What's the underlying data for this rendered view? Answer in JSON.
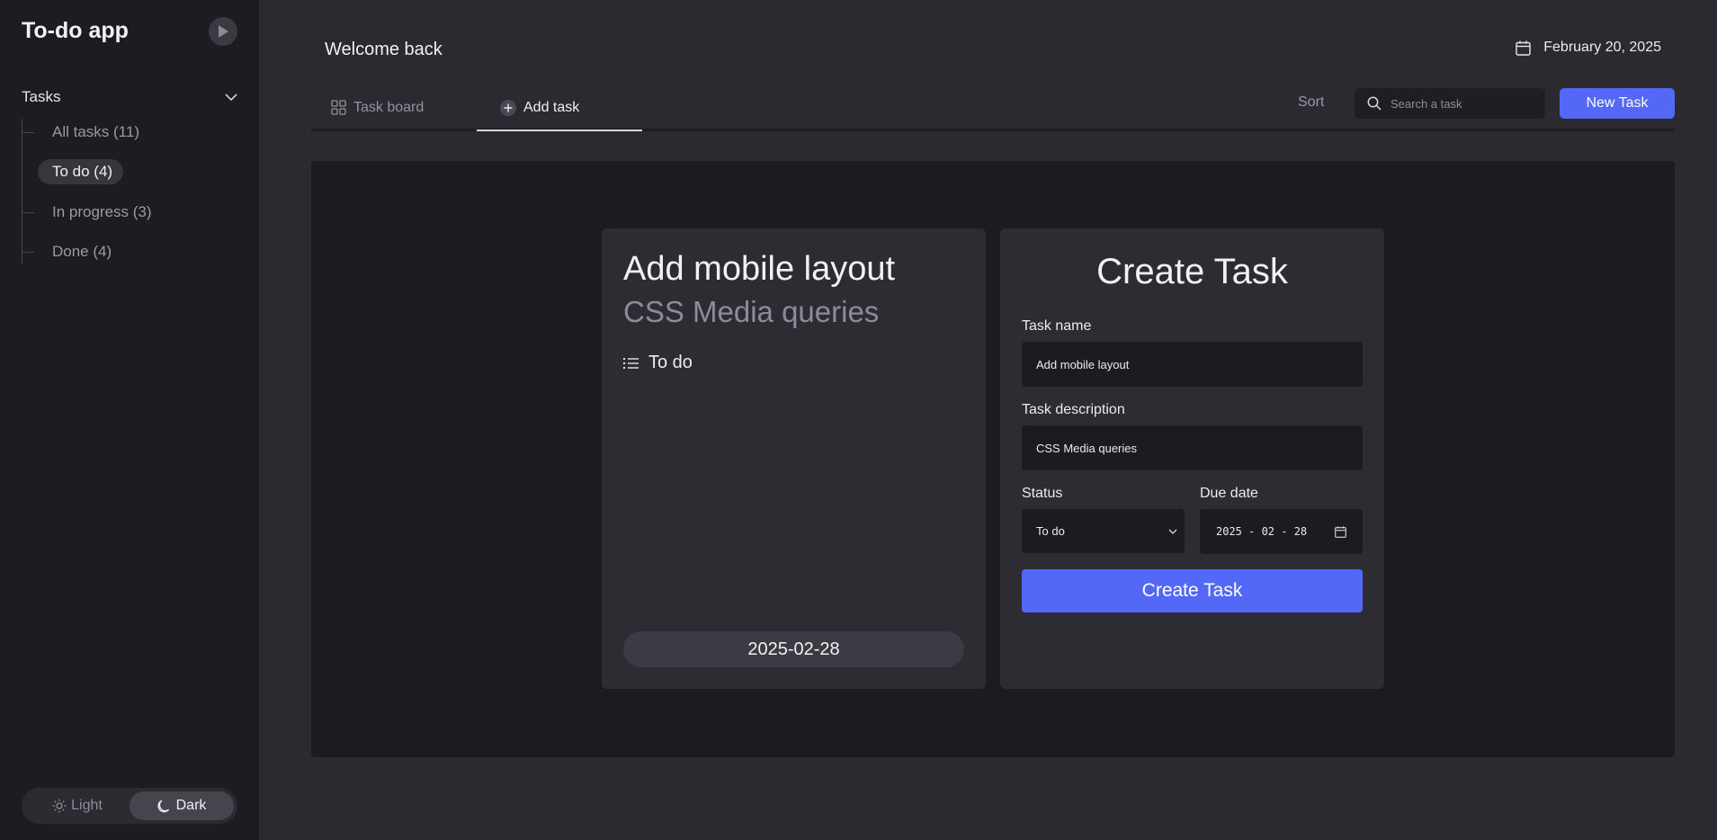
{
  "sidebar": {
    "app_title": "To-do app",
    "section_title": "Tasks",
    "items": [
      {
        "label": "All tasks (11)"
      },
      {
        "label": "To do (4)"
      },
      {
        "label": "In progress (3)"
      },
      {
        "label": "Done (4)"
      }
    ],
    "theme": {
      "light": "Light",
      "dark": "Dark"
    }
  },
  "header": {
    "welcome": "Welcome back",
    "date": "February 20, 2025"
  },
  "tabs": {
    "board": "Task board",
    "add": "Add task"
  },
  "toolbar": {
    "sort": "Sort",
    "search_placeholder": "Search a task",
    "new_task": "New Task"
  },
  "preview": {
    "title": "Add mobile layout",
    "description": "CSS Media queries",
    "status": "To do",
    "due_date": "2025-02-28"
  },
  "form": {
    "title": "Create Task",
    "name_label": "Task name",
    "name_value": "Add mobile layout",
    "desc_label": "Task description",
    "desc_value": "CSS Media queries",
    "status_label": "Status",
    "status_value": "To do",
    "due_label": "Due date",
    "due_value": "2025 - 02 - 28",
    "submit": "Create Task"
  },
  "colors": {
    "accent": "#5468f7",
    "sidebar_bg": "#1c1c21",
    "page_bg": "#2a2a30",
    "panel_bg": "#1b1b20",
    "card_bg": "#2c2c32"
  }
}
